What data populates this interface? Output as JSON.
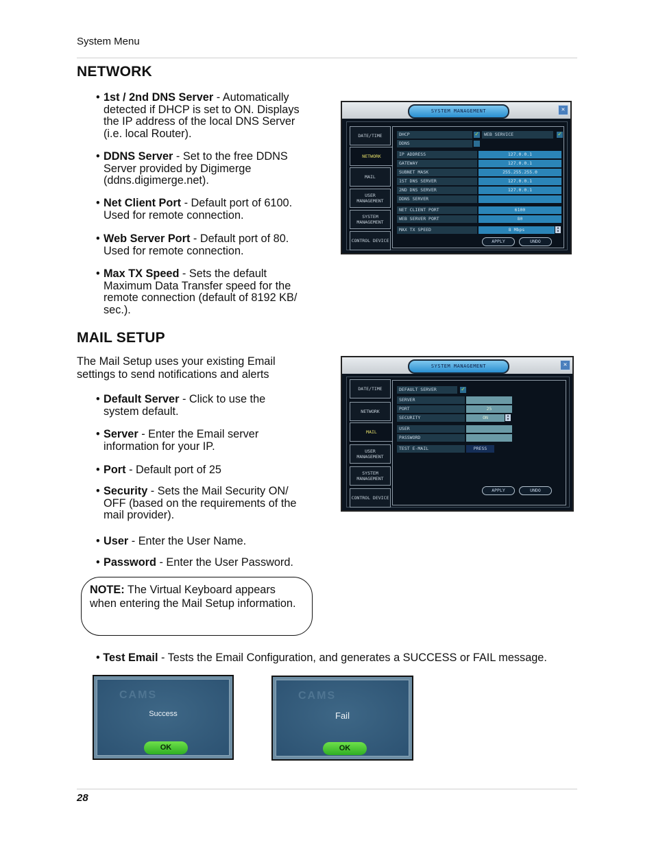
{
  "header": {
    "section_label": "System Menu"
  },
  "network": {
    "heading": "NETWORK",
    "bullets": [
      {
        "term": "1st / 2nd DNS Server",
        "lines": [
          "- Automatically",
          "detected if DHCP is set to ON. Displays",
          "the IP address of the local DNS Server",
          "(i.e. local Router)."
        ]
      },
      {
        "term": "DDNS Server",
        "lines": [
          "- Set to the free DDNS",
          "Server provided by Digimerge",
          "(ddns.digimerge.net)."
        ]
      },
      {
        "term": "Net Client Port",
        "lines": [
          "- Default port of 6100.",
          "Used for remote connection."
        ]
      },
      {
        "term": "Web Server Port",
        "lines": [
          "- Default port of 80.",
          "Used for remote connection."
        ]
      },
      {
        "term": "Max TX Speed",
        "lines": [
          "- Sets the default",
          "Maximum Data Transfer speed for the",
          "remote connection (default of 8192 KB/",
          "sec.)."
        ]
      }
    ],
    "screen": {
      "title": "SYSTEM MANAGEMENT",
      "close": "✕",
      "tabs": [
        "DATE/TIME",
        "NETWORK",
        "MAIL",
        "USER MANAGEMENT",
        "SYSTEM MANAGEMENT",
        "CONTROL DEVICE"
      ],
      "active_tab": "NETWORK",
      "dhcp": {
        "label": "DHCP",
        "checked": true
      },
      "web_service": {
        "label": "WEB SERVICE",
        "checked": true
      },
      "ddns": {
        "label": "DDNS",
        "checked": false
      },
      "fields": [
        {
          "label": "IP ADDRESS",
          "value": "127.0.0.1"
        },
        {
          "label": "GATEWAY",
          "value": "127.0.0.1"
        },
        {
          "label": "SUBNET MASK",
          "value": "255.255.255.0"
        },
        {
          "label": "1ST DNS SERVER",
          "value": "127.0.0.1"
        },
        {
          "label": "2ND DNS SERVER",
          "value": "127.0.0.1"
        },
        {
          "label": "DDNS SERVER",
          "value": ""
        },
        {
          "label": "NET CLIENT PORT",
          "value": "6100"
        },
        {
          "label": "WEB SERVER PORT",
          "value": "80"
        },
        {
          "label": "MAX TX SPEED",
          "value": "8 Mbps"
        }
      ],
      "apply": "APPLY",
      "undo": "UNDO"
    }
  },
  "mail": {
    "heading": "MAIL SETUP",
    "intro": [
      "The Mail Setup uses your existing Email",
      "settings to send notifications and alerts"
    ],
    "bullets": [
      {
        "term": "Default Server",
        "lines": [
          "- Click to use the",
          "system default."
        ]
      },
      {
        "term": "Server",
        "lines": [
          "- Enter the Email server",
          "information for your IP."
        ]
      },
      {
        "term": "Port",
        "lines": [
          "- Default port of 25"
        ]
      },
      {
        "term": "Security",
        "lines": [
          "- Sets the Mail Security ON/",
          "OFF (based on the requirements of the",
          "mail provider)."
        ]
      },
      {
        "term": "User",
        "lines": [
          "- Enter the User Name."
        ]
      },
      {
        "term": "Password",
        "lines": [
          "- Enter the User Password."
        ]
      }
    ],
    "note": {
      "label": "NOTE:",
      "text": "The Virtual Keyboard appears when entering the Mail Setup information."
    },
    "test_email": {
      "term": "Test Email",
      "text": "- Tests the Email Configuration, and generates a SUCCESS or FAIL message."
    },
    "screen": {
      "title": "SYSTEM MANAGEMENT",
      "close": "✕",
      "tabs": [
        "DATE/TIME",
        "NETWORK",
        "MAIL",
        "USER MANAGEMENT",
        "SYSTEM MANAGEMENT",
        "CONTROL DEVICE"
      ],
      "active_tab": "MAIL",
      "default_server": {
        "label": "DEFAULT SERVER",
        "checked": true
      },
      "fields": [
        {
          "label": "SERVER",
          "value": ""
        },
        {
          "label": "PORT",
          "value": "25"
        },
        {
          "label": "SECURITY",
          "value": "ON"
        },
        {
          "label": "USER",
          "value": ""
        },
        {
          "label": "PASSWORD",
          "value": ""
        }
      ],
      "test_email": {
        "label": "TEST E-MAIL",
        "button": "PRESS"
      },
      "apply": "APPLY",
      "undo": "UNDO"
    },
    "popups": [
      {
        "brand": "CAMS",
        "message": "Success",
        "ok": "OK"
      },
      {
        "brand": "CAMS",
        "message": "Fail",
        "ok": "OK"
      }
    ]
  },
  "footer": {
    "page_number": "28"
  }
}
